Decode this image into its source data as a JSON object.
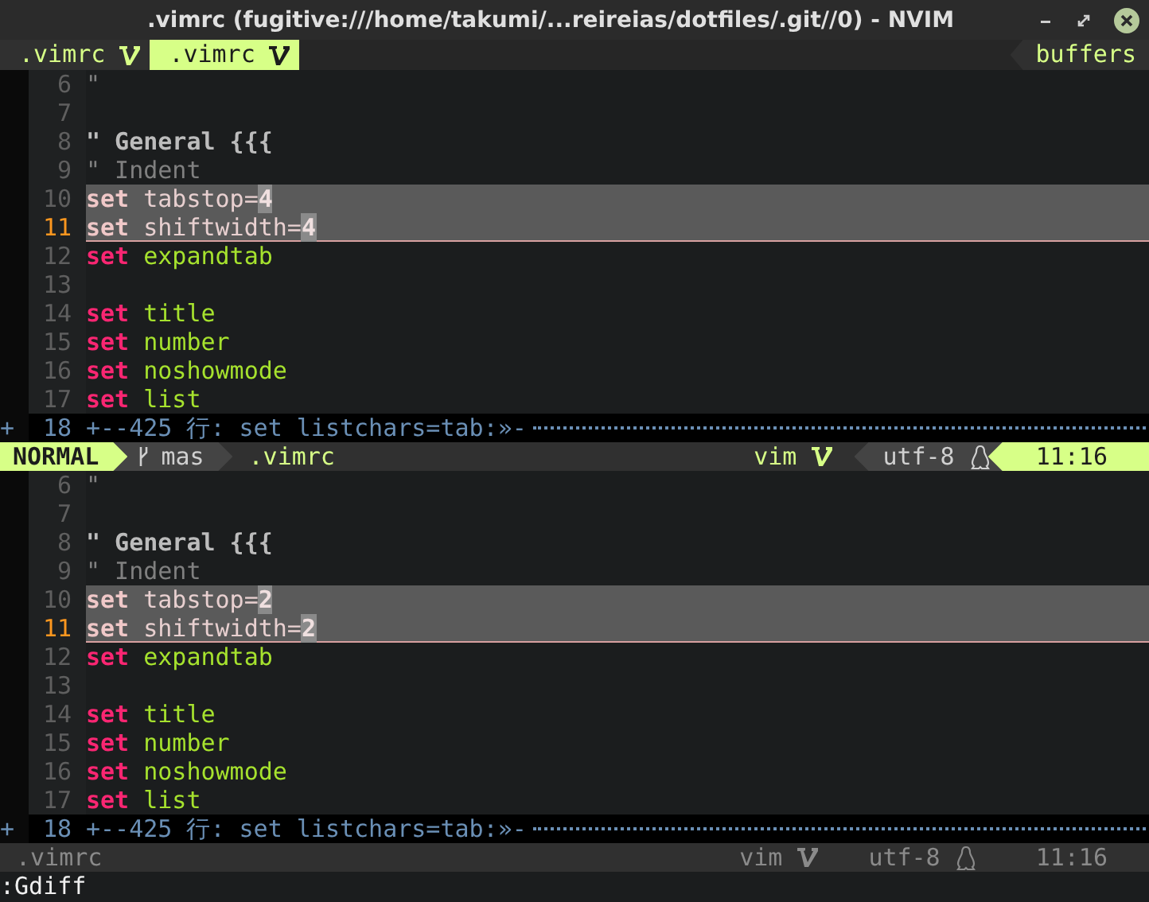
{
  "window": {
    "title": ".vimrc (fugitive:///home/takumi/...reireias/dotfiles/.git//0) - NVIM"
  },
  "tabline": {
    "tabs": [
      {
        "label": ".vimrc",
        "selected": false
      },
      {
        "label": ".vimrc",
        "selected": true
      }
    ],
    "right_label": "buffers"
  },
  "panes": [
    {
      "lines": [
        {
          "number": "6",
          "diff": false,
          "current": false,
          "segments": [
            {
              "text": "\"",
              "kind": "comment"
            }
          ]
        },
        {
          "number": "7",
          "diff": false,
          "current": false
        },
        {
          "number": "8",
          "diff": false,
          "current": false,
          "segments": [
            {
              "text": "\" General {{{",
              "kind": "heading"
            }
          ]
        },
        {
          "number": "9",
          "diff": false,
          "current": false,
          "segments": [
            {
              "text": "\" Indent",
              "kind": "comment"
            }
          ]
        },
        {
          "number": "10",
          "diff": true,
          "current": false,
          "segments": [
            {
              "text": "set",
              "kind": "keyword"
            },
            {
              "text": " tabstop=",
              "kind": "plain"
            },
            {
              "text": "4",
              "kind": "diff-text"
            }
          ]
        },
        {
          "number": "11",
          "diff": true,
          "current": true,
          "segments": [
            {
              "text": "set",
              "kind": "keyword"
            },
            {
              "text": " shiftwidth=",
              "kind": "plain"
            },
            {
              "text": "4",
              "kind": "diff-text"
            }
          ]
        },
        {
          "number": "12",
          "diff": false,
          "current": false,
          "segments": [
            {
              "text": "set",
              "kind": "keyword"
            },
            {
              "text": " expandtab",
              "kind": "option"
            }
          ]
        },
        {
          "number": "13",
          "diff": false,
          "current": false
        },
        {
          "number": "14",
          "diff": false,
          "current": false,
          "segments": [
            {
              "text": "set",
              "kind": "keyword"
            },
            {
              "text": " title",
              "kind": "option"
            }
          ]
        },
        {
          "number": "15",
          "diff": false,
          "current": false,
          "segments": [
            {
              "text": "set",
              "kind": "keyword"
            },
            {
              "text": " number",
              "kind": "option"
            }
          ]
        },
        {
          "number": "16",
          "diff": false,
          "current": false,
          "segments": [
            {
              "text": "set",
              "kind": "keyword"
            },
            {
              "text": " noshowmode",
              "kind": "option"
            }
          ]
        },
        {
          "number": "17",
          "diff": false,
          "current": false,
          "segments": [
            {
              "text": "set",
              "kind": "keyword"
            },
            {
              "text": " list",
              "kind": "option"
            }
          ]
        }
      ],
      "fold": {
        "sign": "+",
        "number": "18",
        "text": "+--425 行: set listchars=tab:»-"
      },
      "statusline": {
        "active": true,
        "mode": "NORMAL",
        "branch": "mas",
        "file": ".vimrc",
        "filetype": "vim",
        "encoding": "utf-8",
        "position": "11:16"
      }
    },
    {
      "lines": [
        {
          "number": "6",
          "diff": false,
          "current": false,
          "segments": [
            {
              "text": "\"",
              "kind": "comment"
            }
          ]
        },
        {
          "number": "7",
          "diff": false,
          "current": false
        },
        {
          "number": "8",
          "diff": false,
          "current": false,
          "segments": [
            {
              "text": "\" General {{{",
              "kind": "heading"
            }
          ]
        },
        {
          "number": "9",
          "diff": false,
          "current": false,
          "segments": [
            {
              "text": "\" Indent",
              "kind": "comment"
            }
          ]
        },
        {
          "number": "10",
          "diff": true,
          "current": false,
          "segments": [
            {
              "text": "set",
              "kind": "keyword"
            },
            {
              "text": " tabstop=",
              "kind": "plain"
            },
            {
              "text": "2",
              "kind": "diff-text"
            }
          ]
        },
        {
          "number": "11",
          "diff": true,
          "current": true,
          "segments": [
            {
              "text": "set",
              "kind": "keyword"
            },
            {
              "text": " shiftwidth=",
              "kind": "plain"
            },
            {
              "text": "2",
              "kind": "diff-text"
            }
          ]
        },
        {
          "number": "12",
          "diff": false,
          "current": false,
          "segments": [
            {
              "text": "set",
              "kind": "keyword"
            },
            {
              "text": " expandtab",
              "kind": "option"
            }
          ]
        },
        {
          "number": "13",
          "diff": false,
          "current": false
        },
        {
          "number": "14",
          "diff": false,
          "current": false,
          "segments": [
            {
              "text": "set",
              "kind": "keyword"
            },
            {
              "text": " title",
              "kind": "option"
            }
          ]
        },
        {
          "number": "15",
          "diff": false,
          "current": false,
          "segments": [
            {
              "text": "set",
              "kind": "keyword"
            },
            {
              "text": " number",
              "kind": "option"
            }
          ]
        },
        {
          "number": "16",
          "diff": false,
          "current": false,
          "segments": [
            {
              "text": "set",
              "kind": "keyword"
            },
            {
              "text": " noshowmode",
              "kind": "option"
            }
          ]
        },
        {
          "number": "17",
          "diff": false,
          "current": false,
          "segments": [
            {
              "text": "set",
              "kind": "keyword"
            },
            {
              "text": " list",
              "kind": "option"
            }
          ]
        }
      ],
      "fold": {
        "sign": "+",
        "number": "18",
        "text": "+--425 行: set listchars=tab:»-"
      },
      "statusline": {
        "active": false,
        "file": ".vimrc",
        "filetype": "vim",
        "encoding": "utf-8",
        "position": "11:16"
      }
    }
  ],
  "command_line": ":Gdiff"
}
